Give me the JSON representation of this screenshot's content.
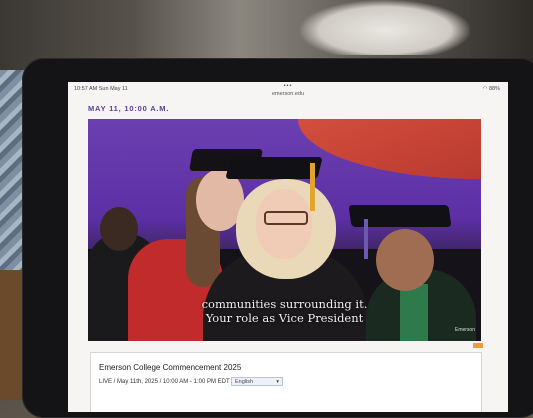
{
  "status_bar": {
    "time": "10:57 AM   Sun May 11",
    "url": "emerson.edu",
    "dots": "•••",
    "battery": "88%"
  },
  "event": {
    "date_heading": "MAY 11, 10:00 A.M."
  },
  "video": {
    "caption_lines": [
      "communities surrounding it.",
      "Your role as Vice President"
    ],
    "watermark": "Emerson"
  },
  "info_card": {
    "title": "Emerson College Commencement 2025",
    "subtitle": "LIVE / May 11th, 2025 / 10:00 AM - 1:00 PM EDT |",
    "language": "English"
  },
  "colors": {
    "date_accent": "#5a3d99",
    "stage_purple": "#5c2fa5",
    "caption_text": "#f0f0ee"
  }
}
